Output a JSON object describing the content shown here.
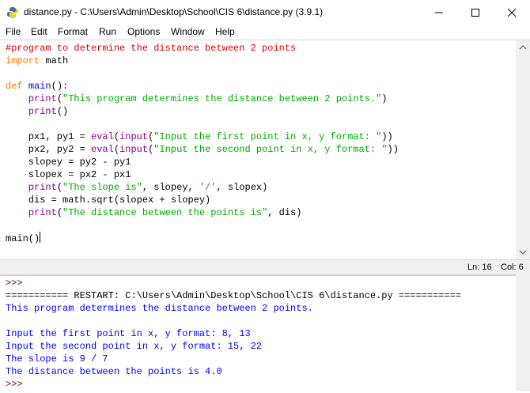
{
  "window": {
    "title": "distance.py - C:\\Users\\Admin\\Desktop\\School\\CIS 6\\distance.py (3.9.1)"
  },
  "menu": [
    "File",
    "Edit",
    "Format",
    "Run",
    "Options",
    "Window",
    "Help"
  ],
  "editor": {
    "lines": [
      [
        {
          "t": "#program to determine the distance between 2 points",
          "c": "com"
        }
      ],
      [
        {
          "t": "import",
          "c": "kw"
        },
        {
          "t": " math",
          "c": ""
        }
      ],
      [],
      [
        {
          "t": "def",
          "c": "kw"
        },
        {
          "t": " ",
          "c": ""
        },
        {
          "t": "main",
          "c": "fn"
        },
        {
          "t": "():",
          "c": ""
        }
      ],
      [
        {
          "t": "    ",
          "c": ""
        },
        {
          "t": "print",
          "c": "bi"
        },
        {
          "t": "(",
          "c": ""
        },
        {
          "t": "\"This program determines the distance between 2 points.\"",
          "c": "str"
        },
        {
          "t": ")",
          "c": ""
        }
      ],
      [
        {
          "t": "    ",
          "c": ""
        },
        {
          "t": "print",
          "c": "bi"
        },
        {
          "t": "()",
          "c": ""
        }
      ],
      [],
      [
        {
          "t": "    px1, py1 = ",
          "c": ""
        },
        {
          "t": "eval",
          "c": "bi"
        },
        {
          "t": "(",
          "c": ""
        },
        {
          "t": "input",
          "c": "bi"
        },
        {
          "t": "(",
          "c": ""
        },
        {
          "t": "\"Input the first point in x, y format: \"",
          "c": "str"
        },
        {
          "t": "))",
          "c": ""
        }
      ],
      [
        {
          "t": "    px2, py2 = ",
          "c": ""
        },
        {
          "t": "eval",
          "c": "bi"
        },
        {
          "t": "(",
          "c": ""
        },
        {
          "t": "input",
          "c": "bi"
        },
        {
          "t": "(",
          "c": ""
        },
        {
          "t": "\"Input the second point in x, y format: \"",
          "c": "str"
        },
        {
          "t": "))",
          "c": ""
        }
      ],
      [
        {
          "t": "    slopey = py2 - py1",
          "c": ""
        }
      ],
      [
        {
          "t": "    slopex = px2 - px1",
          "c": ""
        }
      ],
      [
        {
          "t": "    ",
          "c": ""
        },
        {
          "t": "print",
          "c": "bi"
        },
        {
          "t": "(",
          "c": ""
        },
        {
          "t": "\"The slope is\"",
          "c": "str"
        },
        {
          "t": ", slopey, ",
          "c": ""
        },
        {
          "t": "'/'",
          "c": "str"
        },
        {
          "t": ", slopex)",
          "c": ""
        }
      ],
      [
        {
          "t": "    dis = math.sqrt(slopex + slopey)",
          "c": ""
        }
      ],
      [
        {
          "t": "    ",
          "c": ""
        },
        {
          "t": "print",
          "c": "bi"
        },
        {
          "t": "(",
          "c": ""
        },
        {
          "t": "\"The distance between the points is\"",
          "c": "str"
        },
        {
          "t": ", dis)",
          "c": ""
        }
      ],
      [],
      [
        {
          "t": "main()",
          "c": ""
        }
      ]
    ]
  },
  "status": {
    "line": "Ln: 16",
    "col": "Col: 6"
  },
  "shell": {
    "lines": [
      {
        "t": ">>> ",
        "c": "prompt"
      },
      {
        "t": "=========== RESTART: C:\\Users\\Admin\\Desktop\\School\\CIS 6\\distance.py ===========",
        "c": "norm"
      },
      {
        "t": "This program determines the distance between 2 points.",
        "c": "out"
      },
      {
        "t": "",
        "c": "out"
      },
      {
        "t": "Input the first point in x, y format: 8, 13",
        "c": "out"
      },
      {
        "t": "Input the second point in x, y format: 15, 22",
        "c": "out"
      },
      {
        "t": "The slope is 9 / 7",
        "c": "out"
      },
      {
        "t": "The distance between the points is 4.0",
        "c": "out"
      },
      {
        "t": ">>> ",
        "c": "prompt"
      }
    ]
  },
  "icons": {
    "app": "python-idle-icon",
    "minimize": "minimize-icon",
    "maximize": "maximize-icon",
    "close": "close-icon"
  }
}
